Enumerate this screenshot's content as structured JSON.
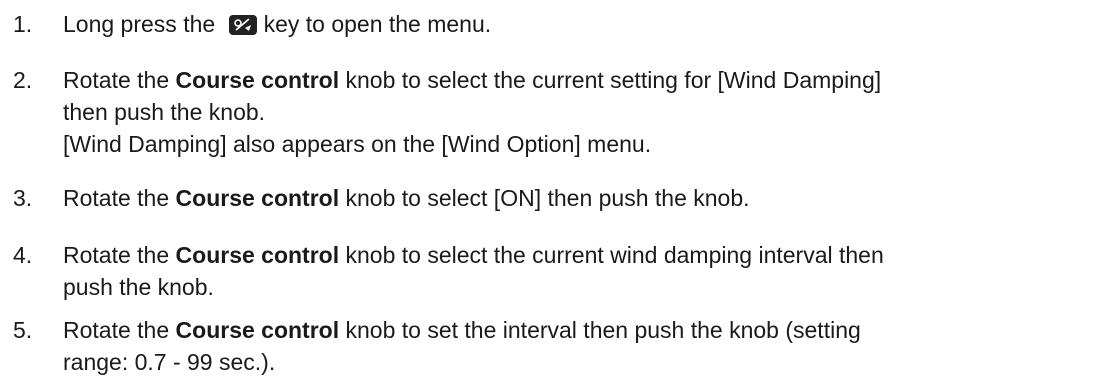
{
  "steps": [
    {
      "num": "1.",
      "lines": [
        {
          "parts": [
            "Long press the ",
            "key to open the menu."
          ]
        }
      ],
      "icon": "menu-key-icon"
    },
    {
      "num": "2.",
      "lines": [
        {
          "pre": "Rotate the ",
          "bold": "Course control",
          "post": " knob to select the current setting for [Wind Damping]"
        },
        {
          "text": "then push the knob."
        },
        {
          "text": "[Wind Damping] also appears on the [Wind Option] menu."
        }
      ]
    },
    {
      "num": "3.",
      "lines": [
        {
          "pre": "Rotate the ",
          "bold": "Course control",
          "post": " knob to select [ON] then push the knob."
        }
      ]
    },
    {
      "num": "4.",
      "lines": [
        {
          "pre": "Rotate the ",
          "bold": "Course control",
          "post": " knob to select the current wind damping interval then"
        },
        {
          "text": "push the knob."
        }
      ]
    },
    {
      "num": "5.",
      "lines": [
        {
          "pre": "Rotate the ",
          "bold": "Course control",
          "post": " knob to set the interval then push the knob (setting"
        },
        {
          "text": "range: 0.7 - 99 sec.)."
        }
      ]
    }
  ]
}
